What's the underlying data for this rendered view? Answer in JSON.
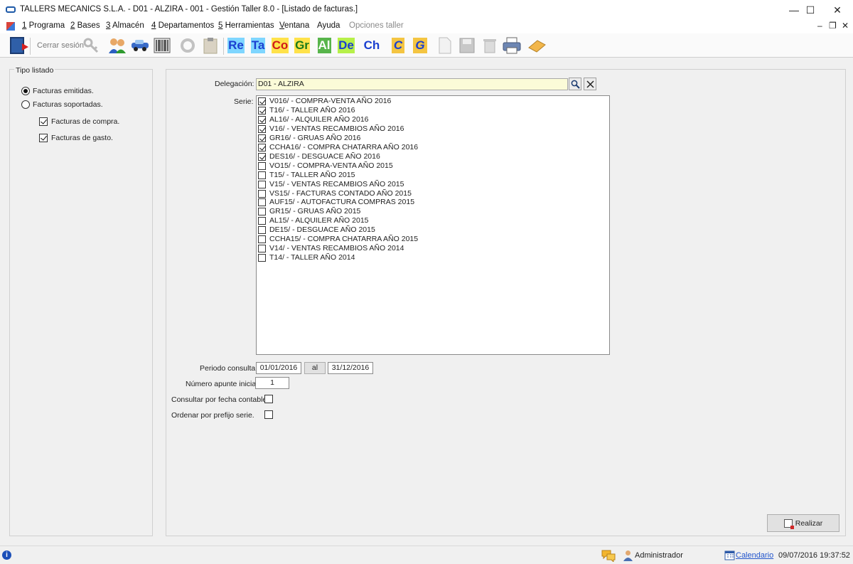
{
  "window": {
    "title": "TALLERS MECANICS S.L.A. - D01 - ALZIRA - 001 - Gestión Taller 8.0 - [Listado de facturas.]",
    "controls": {
      "minimize": "—",
      "maximize": "☐",
      "close": "✕"
    }
  },
  "menu": {
    "items": [
      {
        "key": "1",
        "label": " Programa"
      },
      {
        "key": "2",
        "label": " Bases"
      },
      {
        "key": "3",
        "label": " Almacén"
      },
      {
        "key": "4",
        "label": " Departamentos"
      },
      {
        "key": "5",
        "label": " Herramientas"
      },
      {
        "key": "V",
        "label": "entana"
      },
      {
        "key": "",
        "label": "Ayuda"
      },
      {
        "key": "",
        "label": "Opciones taller"
      }
    ],
    "mdi_controls": {
      "minimize": "–",
      "restore": "❐",
      "close": "✕"
    }
  },
  "toolbar": {
    "logout_text": "Cerrar sesión",
    "text_buttons": [
      {
        "label": "Re",
        "color": "#1a3fd0",
        "bg": "#7fd6ff"
      },
      {
        "label": "Ta",
        "color": "#1a3fd0",
        "bg": "#7fd6ff"
      },
      {
        "label": "Co",
        "color": "#d01a1a",
        "bg": "#ffe24a"
      },
      {
        "label": "Gr",
        "color": "#1a7a1a",
        "bg": "#ffe24a"
      },
      {
        "label": "Al",
        "color": "#ffffff",
        "bg": "#58b54b"
      },
      {
        "label": "De",
        "color": "#1a3fd0",
        "bg": "#b7f04a"
      },
      {
        "label": "Ch",
        "color": "#1a3fd0",
        "bg": "#f5f5f5"
      },
      {
        "label": "C",
        "color": "#1a3fd0",
        "bg": "#f4c542"
      },
      {
        "label": "G",
        "color": "#1a3fd0",
        "bg": "#f4c542"
      }
    ]
  },
  "left_panel": {
    "group_title": "Tipo listado",
    "radio_emitidas": "Facturas emitidas.",
    "radio_soportadas": "Facturas soportadas.",
    "chk_compra": "Facturas de compra.",
    "chk_gasto": "Facturas de gasto."
  },
  "form": {
    "delegacion_label": "Delegación:",
    "delegacion_value": "D01 - ALZIRA",
    "serie_label": "Serie:",
    "series": [
      {
        "label": "V016/ - COMPRA-VENTA AÑO 2016",
        "checked": true
      },
      {
        "label": "T16/ - TALLER AÑO 2016",
        "checked": true
      },
      {
        "label": "AL16/ - ALQUILER AÑO 2016",
        "checked": true
      },
      {
        "label": "V16/ - VENTAS RECAMBIOS AÑO 2016",
        "checked": true
      },
      {
        "label": "GR16/ - GRUAS AÑO 2016",
        "checked": true
      },
      {
        "label": "CCHA16/ - COMPRA CHATARRA AÑO 2016",
        "checked": true
      },
      {
        "label": "DES16/ - DESGUACE AÑO 2016",
        "checked": true
      },
      {
        "label": "VO15/ - COMPRA-VENTA AÑO 2015",
        "checked": false
      },
      {
        "label": "T15/ - TALLER AÑO 2015",
        "checked": false
      },
      {
        "label": "V15/ - VENTAS RECAMBIOS AÑO 2015",
        "checked": false
      },
      {
        "label": "VS15/ - FACTURAS CONTADO AÑO 2015",
        "checked": false
      },
      {
        "label": "AUF15/ - AUTOFACTURA COMPRAS 2015",
        "checked": false
      },
      {
        "label": "GR15/ - GRUAS AÑO 2015",
        "checked": false
      },
      {
        "label": "AL15/ - ALQUILER AÑO 2015",
        "checked": false
      },
      {
        "label": "DE15/ - DESGUACE AÑO 2015",
        "checked": false
      },
      {
        "label": "CCHA15/ - COMPRA CHATARRA AÑO 2015",
        "checked": false
      },
      {
        "label": "V14/ - VENTAS RECAMBIOS AÑO 2014",
        "checked": false
      },
      {
        "label": "T14/ - TALLER AÑO 2014",
        "checked": false
      }
    ],
    "periodo_label": "Periodo consulta:",
    "periodo_desde": "01/01/2016",
    "periodo_al": "al",
    "periodo_hasta": "31/12/2016",
    "apunte_label": "Número apunte inicial:",
    "apunte_value": "1",
    "fecha_contable_label": "Consultar por fecha contable.",
    "ordenar_label": "Ordenar por prefijo serie.",
    "realizar_label": "Realizar"
  },
  "status": {
    "user": "Administrador",
    "calendar": "Calendario",
    "datetime": "09/07/2016 19:37:52"
  }
}
